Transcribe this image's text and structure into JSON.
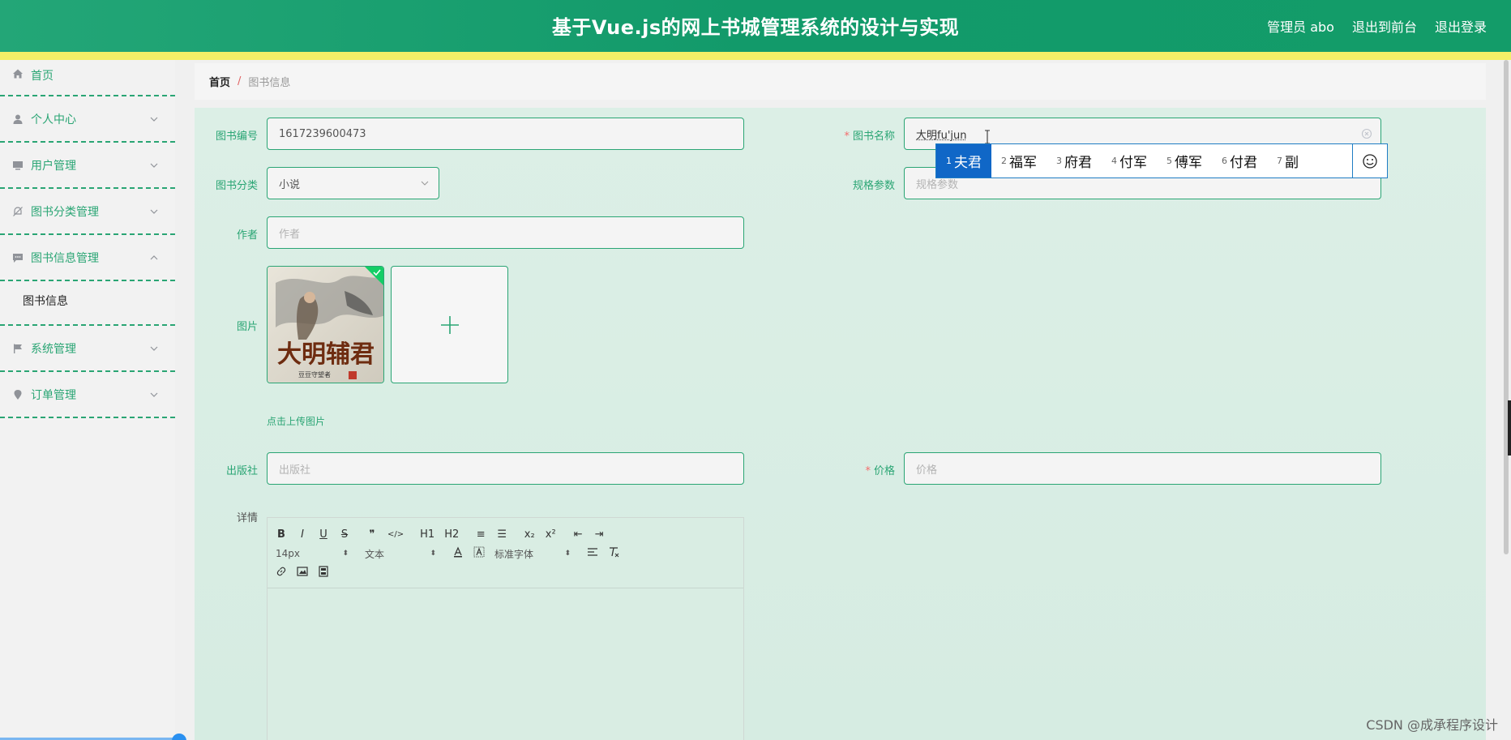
{
  "header": {
    "title": "基于Vue.js的网上书城管理系统的设计与实现",
    "user": "管理员 abo",
    "to_front": "退出到前台",
    "logout": "退出登录"
  },
  "sidebar": {
    "items": [
      {
        "label": "首页",
        "icon": "home-icon"
      },
      {
        "label": "个人中心",
        "icon": "user-icon"
      },
      {
        "label": "用户管理",
        "icon": "monitor-icon"
      },
      {
        "label": "图书分类管理",
        "icon": "bell-off-icon"
      },
      {
        "label": "图书信息管理",
        "icon": "message-icon"
      },
      {
        "label": "系统管理",
        "icon": "flag-icon"
      },
      {
        "label": "订单管理",
        "icon": "location-icon"
      }
    ],
    "submenu": "图书信息"
  },
  "breadcrumb": {
    "home": "首页",
    "sep": "/",
    "current": "图书信息"
  },
  "form": {
    "book_no_label": "图书编号",
    "book_no_value": "1617239600473",
    "book_name_label": "图书名称",
    "book_name_value": "大明fu'jun",
    "category_label": "图书分类",
    "category_value": "小说",
    "spec_label": "规格参数",
    "spec_placeholder": "规格参数",
    "author_label": "作者",
    "author_placeholder": "作者",
    "image_label": "图片",
    "upload_tip": "点击上传图片",
    "cover_title": "大明辅君",
    "cover_author": "豆豆守望者",
    "publisher_label": "出版社",
    "publisher_placeholder": "出版社",
    "price_label": "价格",
    "price_placeholder": "价格",
    "detail_label": "详情",
    "required_mark": "*"
  },
  "editor": {
    "row1": [
      "B",
      "I",
      "U",
      "S",
      "❞",
      "</>",
      "H1",
      "H2",
      "≡",
      "☰",
      "x₂",
      "x²",
      "⇤",
      "⇥"
    ],
    "font_size": "14px",
    "text_type": "文本",
    "font_family": "标准字体"
  },
  "ime": {
    "candidates": [
      {
        "n": "1",
        "text": "夫君"
      },
      {
        "n": "2",
        "text": "福军"
      },
      {
        "n": "3",
        "text": "府君"
      },
      {
        "n": "4",
        "text": "付军"
      },
      {
        "n": "5",
        "text": "傅军"
      },
      {
        "n": "6",
        "text": "付君"
      },
      {
        "n": "7",
        "text": "副"
      }
    ]
  },
  "watermark": "CSDN @成承程序设计",
  "colors": {
    "primary": "#2aa574",
    "header": "#139c69",
    "strip": "#f3ef67",
    "required": "#f56c6c",
    "ime_active": "#1067c7"
  }
}
